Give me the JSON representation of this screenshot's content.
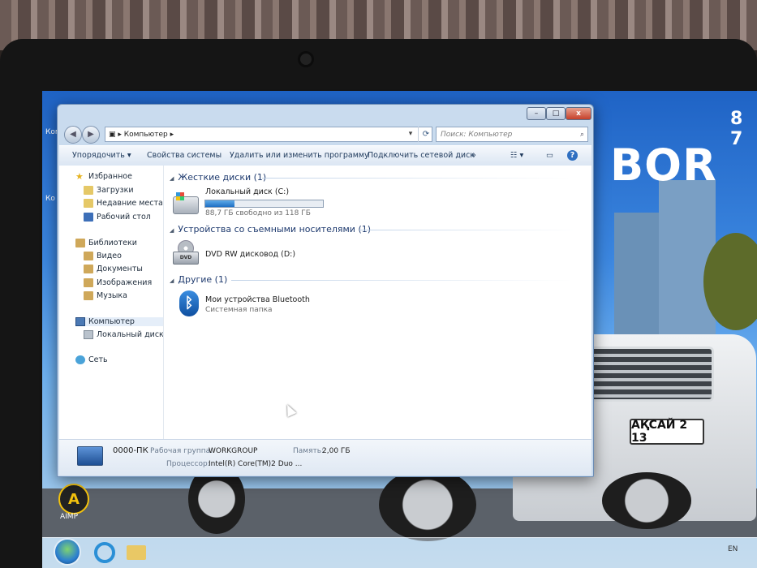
{
  "wallpaper": {
    "phone_fragment": "8 7",
    "brand_fragment": "BOR",
    "plate_text": "АҚСАЙ 2 13",
    "desktop_labels": [
      "Ком",
      "Ко"
    ],
    "aimp_label": "AIMP"
  },
  "taskbar": {
    "lang": "EN"
  },
  "window": {
    "address_path": "Компьютер",
    "search_placeholder": "Поиск: Компьютер",
    "title_buttons": {
      "minimize": "–",
      "maximize": "□",
      "close": "x"
    },
    "nav": {
      "back": "◀",
      "forward": "▶"
    },
    "toolbar": {
      "organize": "Упорядочить ▾",
      "system_properties": "Свойства системы",
      "uninstall": "Удалить или изменить программу",
      "map_drive": "Подключить сетевой диск",
      "more": "»",
      "views": "☷ ▾",
      "preview": "▭",
      "help": "?"
    },
    "navpane": {
      "favorites": "Избранное",
      "downloads": "Загрузки",
      "recent": "Недавние места",
      "desktop": "Рабочий стол",
      "libraries": "Библиотеки",
      "video": "Видео",
      "documents": "Документы",
      "pictures": "Изображения",
      "music": "Музыка",
      "computer": "Компьютер",
      "local_disk": "Локальный диск (С",
      "network": "Сеть"
    },
    "groups": {
      "hard_disks": "Жесткие диски (1)",
      "removable": "Устройства со съемными носителями (1)",
      "other": "Другие (1)"
    },
    "items": {
      "local_disk_name": "Локальный диск (C:)",
      "local_disk_free": "88,7 ГБ свободно из 118 ГБ",
      "local_disk_used_fraction": 0.25,
      "dvd_name": "DVD RW дисковод (D:)",
      "dvd_label": "DVD",
      "bt_name": "Мои устройства Bluetooth",
      "bt_sub": "Системная папка"
    },
    "details": {
      "pc_name": "0000-ПК",
      "workgroup_label": "Рабочая группа:",
      "workgroup_value": "WORKGROUP",
      "memory_label": "Память:",
      "memory_value": "2,00 ГБ",
      "cpu_label": "Процессор:",
      "cpu_value": "Intel(R) Core(TM)2 Duo ..."
    }
  }
}
